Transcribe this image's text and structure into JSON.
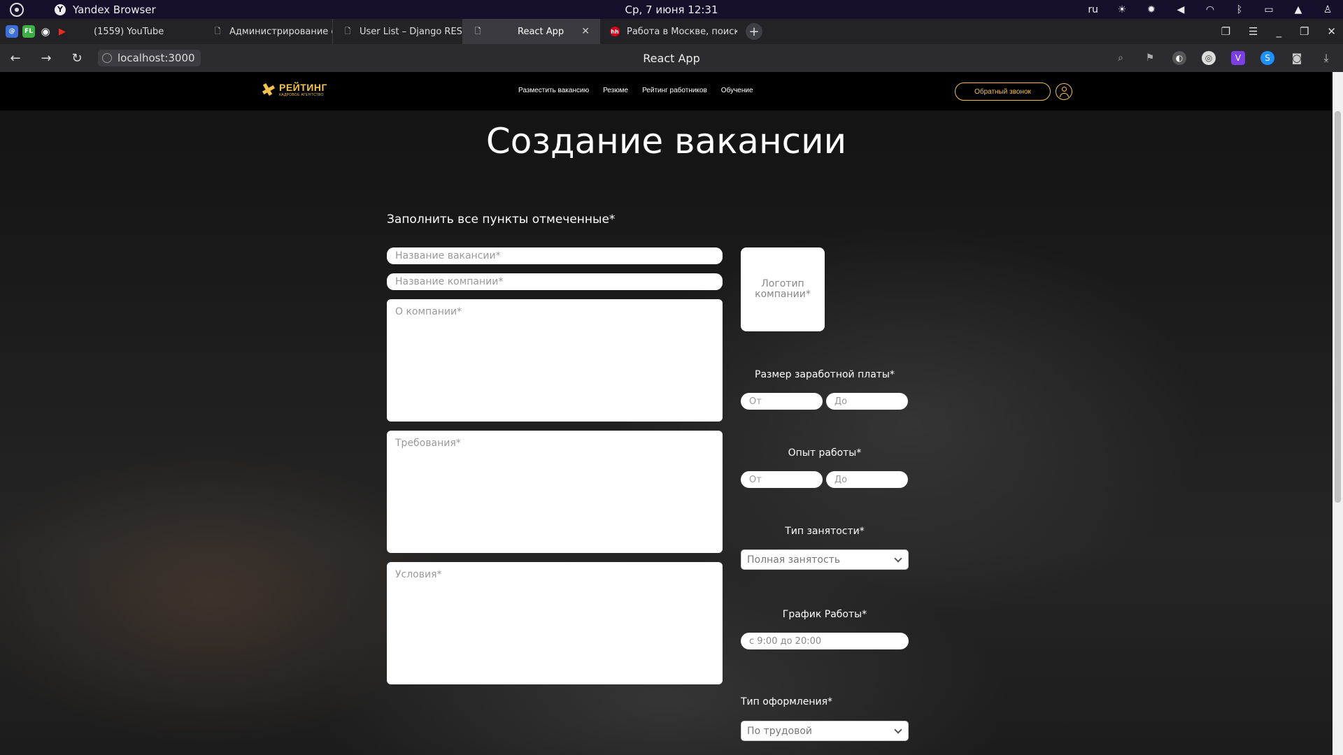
{
  "system": {
    "app_name": "Yandex Browser",
    "datetime": "Ср, 7 июня  12:31",
    "lang": "ru",
    "tray_icons": [
      "brightness-icon",
      "weather-icon",
      "volume-icon",
      "wifi-icon",
      "bluetooth-icon",
      "battery-icon",
      "notification-icon",
      "user-icon"
    ]
  },
  "tabs": {
    "pinned": [
      {
        "name": "mail-pinned-icon",
        "glyph": "@",
        "color": "#3d6fd9"
      },
      {
        "name": "fl-pinned-icon",
        "glyph": "FL",
        "color": "#3cb043"
      },
      {
        "name": "github-pinned-icon",
        "glyph": "◉",
        "color": "#232327"
      },
      {
        "name": "youtube-pinned-icon",
        "glyph": "▶",
        "color": "#e52d27"
      }
    ],
    "items": [
      {
        "label": "(1559) YouTube",
        "active": false
      },
      {
        "label": "Администрирование сай",
        "active": false
      },
      {
        "label": "User List – Django REST fra",
        "active": false
      },
      {
        "label": "React App",
        "active": true
      },
      {
        "label": "Работа в Москве, поиск п",
        "active": false
      }
    ]
  },
  "address": {
    "url": "localhost:3000",
    "page_title": "React App"
  },
  "site": {
    "logo_text": "РЕЙТИНГ",
    "logo_sub": "КАДРОВОЕ АГЕНТСТВО",
    "nav": [
      "Разместить вакансию",
      "Резюме",
      "Рейтинг работников",
      "Обучение"
    ],
    "callback_label": "Обратный звонок"
  },
  "form": {
    "title": "Создание вакансии",
    "note": "Заполнить все пункты отмеченные*",
    "vacancy_name_placeholder": "Название вакансии*",
    "company_name_placeholder": "Название компании*",
    "about_placeholder": "О компании*",
    "requirements_placeholder": "Требования*",
    "conditions_placeholder": "Условия*",
    "logo_label": "Логотип компании*",
    "salary_label": "Размер заработной платы*",
    "salary_from_placeholder": "От",
    "salary_to_placeholder": "До",
    "experience_label": "Опыт работы*",
    "experience_from_placeholder": "От",
    "experience_to_placeholder": "До",
    "employment_label": "Тип занятости*",
    "employment_value": "Полная занятость",
    "schedule_label": "График Работы*",
    "schedule_value": "с 9:00 до 20:00",
    "contract_label": "Тип оформления*",
    "contract_value": "По трудовой"
  },
  "colors": {
    "accent": "#f2c14e",
    "header_bg": "#000000",
    "sysbar_bg": "#160f2b"
  }
}
